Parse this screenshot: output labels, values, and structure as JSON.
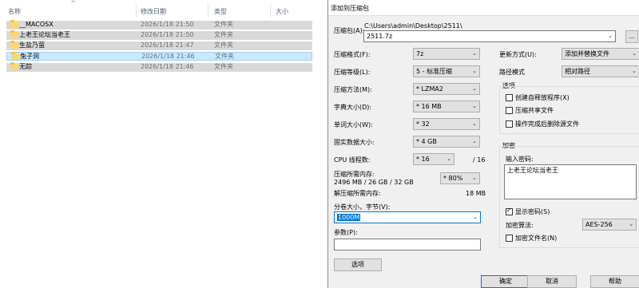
{
  "explorer": {
    "columns": {
      "name": "名称",
      "date": "修改日期",
      "type": "类型",
      "size": "大小"
    },
    "sort_caret": "^",
    "files": [
      {
        "name": "__MACOSX",
        "date": "2026/1/18 21:50",
        "type": "文件夹"
      },
      {
        "name": "上老王论坛当老王",
        "date": "2026/1/18 21:50",
        "type": "文件夹"
      },
      {
        "name": "生盐乃萤",
        "date": "2026/1/18 21:47",
        "type": "文件夹"
      },
      {
        "name": "兔子洞",
        "date": "2026/1/18 21:46",
        "type": "文件夹"
      },
      {
        "name": "无踪",
        "date": "2026/1/18 21:46",
        "type": "文件夹"
      }
    ]
  },
  "dialog": {
    "title": "添加到压缩包",
    "archive_label": "压缩包(A):",
    "archive_path": "C:\\Users\\admin\\Desktop\\2511\\",
    "archive_name": "2511.7z",
    "browse_label": "...",
    "format_label": "压缩格式(F):",
    "format_value": "7z",
    "level_label": "压缩等级(L):",
    "level_value": "5 - 标准压缩",
    "method_label": "压缩方法(M):",
    "method_value": "* LZMA2",
    "dict_label": "字典大小(D):",
    "dict_value": "* 16 MB",
    "word_label": "单词大小(W):",
    "word_value": "* 32",
    "solid_label": "固实数据大小:",
    "solid_value": "* 4 GB",
    "threads_label": "CPU 线程数:",
    "threads_value": "* 16",
    "threads_total": "/ 16",
    "mem_comp_label": "压缩所需内存:",
    "mem_comp_value": "2496 MB / 26 GB / 32 GB",
    "mem_percent_value": "* 80%",
    "mem_decomp_label": "解压缩所需内存:",
    "mem_decomp_value": "18 MB",
    "split_label": "分卷大小，字节(V):",
    "split_value": "1000M",
    "params_label": "参数(P):",
    "params_value": "",
    "options_button": "选项",
    "update_label": "更新方式(U):",
    "update_value": "添加并替换文件",
    "pathmode_label": "路径模式",
    "pathmode_value": "相对路径",
    "options_group_title": "选项",
    "opt_sfx": "创建自释放程序(X)",
    "opt_shared": "压缩共享文件",
    "opt_delete": "操作完成后删除源文件",
    "encrypt_group_title": "加密",
    "password_label": "输入密码:",
    "password_value": "上老王论坛当老王",
    "show_password": "显示密码(S)",
    "enc_method_label": "加密算法:",
    "enc_method_value": "AES-256",
    "encrypt_names": "加密文件名(N)",
    "ok_button": "确定",
    "cancel_button": "取消",
    "help_button": "帮助",
    "dropdown_arrow": "⌄"
  }
}
